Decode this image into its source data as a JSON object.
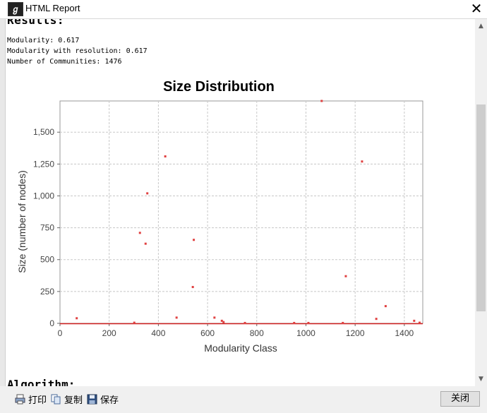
{
  "window": {
    "title": "HTML Report",
    "close_symbol": "✕"
  },
  "report": {
    "results_heading": "Results:",
    "stats": [
      "Modularity: 0.617",
      "Modularity with resolution: 0.617",
      "Number of Communities: 1476"
    ],
    "next_heading": "Algorithm:"
  },
  "bottom_bar": {
    "print_label": "打印",
    "copy_label": "复制",
    "save_label": "保存",
    "close_label": "关闭"
  },
  "colors": {
    "point": "#e04040",
    "baseline": "#d02020",
    "grid": "#c8c8c8",
    "plot_border": "#999999"
  },
  "chart_data": {
    "type": "scatter",
    "title": "Size Distribution",
    "xlabel": "Modularity Class",
    "ylabel": "Size (number of nodes)",
    "xlim": [
      0,
      1475
    ],
    "ylim": [
      0,
      1745
    ],
    "x_ticks": [
      0,
      200,
      400,
      600,
      800,
      1000,
      1200,
      1400
    ],
    "x_tick_labels": [
      "0",
      "200",
      "400",
      "600",
      "800",
      "1000",
      "1200",
      "1400"
    ],
    "y_ticks": [
      0,
      250,
      500,
      750,
      1000,
      1250,
      1500
    ],
    "y_tick_labels": [
      "0",
      "250",
      "500",
      "750",
      "1,000",
      "1,250",
      "1,500"
    ],
    "grid": true,
    "baseline_note": "remaining communities have size near 0 and form a continuous line along y≈0",
    "points": [
      {
        "x": 68,
        "y": 40
      },
      {
        "x": 302,
        "y": 5
      },
      {
        "x": 325,
        "y": 710
      },
      {
        "x": 348,
        "y": 625
      },
      {
        "x": 355,
        "y": 1020
      },
      {
        "x": 428,
        "y": 1310
      },
      {
        "x": 474,
        "y": 45
      },
      {
        "x": 540,
        "y": 285
      },
      {
        "x": 544,
        "y": 655
      },
      {
        "x": 628,
        "y": 45
      },
      {
        "x": 658,
        "y": 20
      },
      {
        "x": 665,
        "y": 10
      },
      {
        "x": 752,
        "y": 3
      },
      {
        "x": 952,
        "y": 3
      },
      {
        "x": 1010,
        "y": 3
      },
      {
        "x": 1064,
        "y": 1745
      },
      {
        "x": 1150,
        "y": 3
      },
      {
        "x": 1162,
        "y": 370
      },
      {
        "x": 1228,
        "y": 1270
      },
      {
        "x": 1286,
        "y": 35
      },
      {
        "x": 1324,
        "y": 135
      },
      {
        "x": 1440,
        "y": 20
      },
      {
        "x": 1462,
        "y": 5
      }
    ]
  }
}
